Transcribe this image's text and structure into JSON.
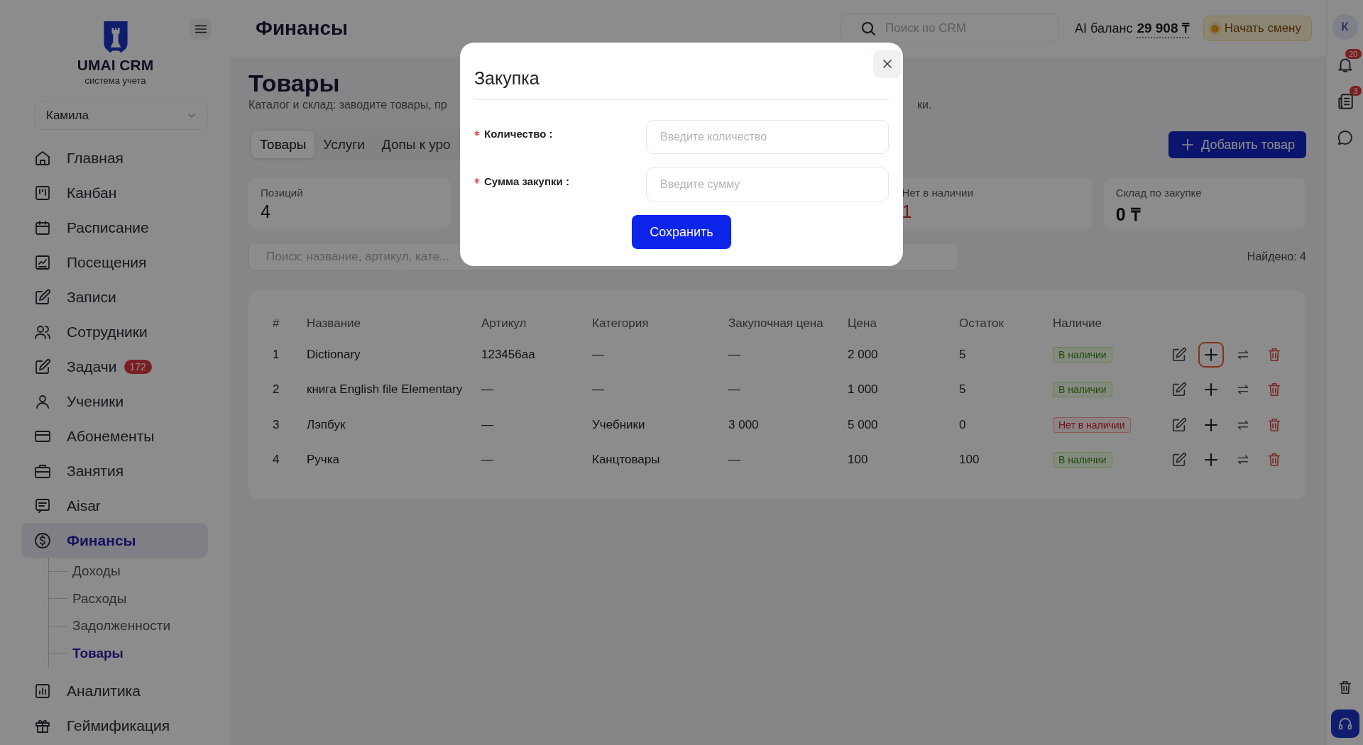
{
  "sidebar": {
    "logo": {
      "title": "UMAI CRM",
      "subtitle": "система учета"
    },
    "user_select": {
      "value": "Камила"
    },
    "items": [
      {
        "label": "Главная",
        "selected": false
      },
      {
        "label": "Канбан",
        "selected": false
      },
      {
        "label": "Расписание",
        "selected": false
      },
      {
        "label": "Посещения",
        "selected": false
      },
      {
        "label": "Записи",
        "selected": false
      },
      {
        "label": "Сотрудники",
        "selected": false
      },
      {
        "label": "Задачи",
        "selected": false,
        "badge": "172"
      },
      {
        "label": "Ученики",
        "selected": false
      },
      {
        "label": "Абонементы",
        "selected": false
      },
      {
        "label": "Занятия",
        "selected": false
      },
      {
        "label": "Aisar",
        "selected": false
      },
      {
        "label": "Финансы",
        "selected": true,
        "expanded": true,
        "children": [
          {
            "label": "Доходы",
            "selected": false
          },
          {
            "label": "Расходы",
            "selected": false
          },
          {
            "label": "Задолженности",
            "selected": false
          },
          {
            "label": "Товары",
            "selected": true
          }
        ]
      },
      {
        "label": "Аналитика",
        "selected": false
      },
      {
        "label": "Геймификация",
        "selected": false
      }
    ]
  },
  "header": {
    "title": "Финансы",
    "search": {
      "placeholder": "Поиск по CRM"
    },
    "ai_balance": {
      "label": "AI баланс",
      "value": "29 908 ₸"
    },
    "shift_button": "Начать смену"
  },
  "rail": {
    "avatar": "К",
    "badges": [
      "20",
      "3"
    ]
  },
  "page": {
    "title": "Товары",
    "subtitle_start": "Каталог и склад: заводите товары, пр",
    "subtitle_end": "ки.",
    "tabs": [
      {
        "label": "Товары",
        "selected": true
      },
      {
        "label": "Услуги",
        "selected": false
      },
      {
        "label": "Допы к уро",
        "selected": false
      }
    ],
    "add_button": "Добавить товар",
    "stats": [
      {
        "label": "Позиций",
        "value": "4",
        "alert": false
      },
      {
        "label": "Нет в наличии",
        "value": "1",
        "alert": true
      },
      {
        "label": "Склад по закупке",
        "value": "0 ₸",
        "alert": false
      }
    ],
    "search": {
      "placeholder": "Поиск: название, артикул, кате..."
    },
    "found": "Найдено: 4",
    "table": {
      "columns": [
        "#",
        "Название",
        "Артикул",
        "Категория",
        "Закупочная цена",
        "Цена",
        "Остаток",
        "Наличие"
      ],
      "rows": [
        {
          "cells": [
            "1",
            "Dictionary",
            "123456aa",
            "—",
            "—",
            "2 000",
            "5"
          ],
          "availability": {
            "text": "В наличии",
            "in_stock": true
          },
          "highlighted": true
        },
        {
          "cells": [
            "2",
            "книга English file Elementary",
            "—",
            "—",
            "—",
            "1 000",
            "5"
          ],
          "availability": {
            "text": "В наличии",
            "in_stock": true
          },
          "highlighted": false
        },
        {
          "cells": [
            "3",
            "Лэпбук",
            "—",
            "Учебники",
            "3 000",
            "5 000",
            "0"
          ],
          "availability": {
            "text": "Нет в наличии",
            "in_stock": false
          },
          "highlighted": false
        },
        {
          "cells": [
            "4",
            "Ручка",
            "—",
            "Канцтовары",
            "—",
            "100",
            "100"
          ],
          "availability": {
            "text": "В наличии",
            "in_stock": true
          },
          "highlighted": false
        }
      ]
    }
  },
  "modal": {
    "title": "Закупка",
    "fields": [
      {
        "label": "Количество :",
        "required": true,
        "placeholder": "Введите количество"
      },
      {
        "label": "Сумма закупки :",
        "required": true,
        "placeholder": "Введите сумму"
      }
    ],
    "save_button": "Сохранить"
  }
}
